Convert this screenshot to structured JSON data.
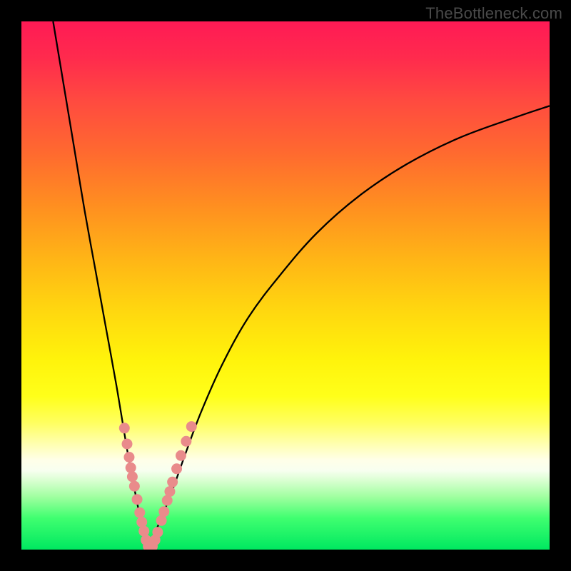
{
  "watermark": "TheBottleneck.com",
  "chart_data": {
    "type": "line",
    "title": "",
    "xlabel": "",
    "ylabel": "",
    "xlim": [
      0,
      100
    ],
    "ylim": [
      0,
      100
    ],
    "note": "Axes unlabeled; values estimated from pixels. Two curves form a V dipping near x≈24, y≈0.",
    "series": [
      {
        "name": "left-curve",
        "x": [
          6,
          8,
          10,
          12,
          14,
          16,
          18,
          20,
          21.5,
          22.5,
          23.5,
          24
        ],
        "y": [
          100,
          88,
          76,
          64,
          53,
          42,
          31,
          19,
          11,
          6,
          2,
          0
        ]
      },
      {
        "name": "right-curve",
        "x": [
          24,
          25,
          26.5,
          28.5,
          31,
          34,
          38,
          43,
          49,
          56,
          64,
          73,
          83,
          94,
          100
        ],
        "y": [
          0,
          2.5,
          6,
          11,
          18,
          26,
          35,
          44,
          52,
          60,
          67,
          73,
          78,
          82,
          84
        ]
      }
    ],
    "scatter_on_curves": {
      "name": "pink-dots",
      "color": "#e98b8b",
      "note": "Clustered along lower V; approximate positions",
      "points": [
        {
          "x": 19.5,
          "y": 23
        },
        {
          "x": 20.0,
          "y": 20
        },
        {
          "x": 20.4,
          "y": 17.5
        },
        {
          "x": 20.7,
          "y": 15.5
        },
        {
          "x": 21.0,
          "y": 13.8
        },
        {
          "x": 21.4,
          "y": 12
        },
        {
          "x": 21.9,
          "y": 9.5
        },
        {
          "x": 22.4,
          "y": 7
        },
        {
          "x": 22.8,
          "y": 5.2
        },
        {
          "x": 23.2,
          "y": 3.5
        },
        {
          "x": 23.6,
          "y": 1.8
        },
        {
          "x": 24.0,
          "y": 0.6
        },
        {
          "x": 24.4,
          "y": 0.6
        },
        {
          "x": 24.8,
          "y": 0.6
        },
        {
          "x": 25.3,
          "y": 1.8
        },
        {
          "x": 25.8,
          "y": 3.3
        },
        {
          "x": 26.5,
          "y": 5.5
        },
        {
          "x": 27.0,
          "y": 7.2
        },
        {
          "x": 27.6,
          "y": 9.3
        },
        {
          "x": 28.1,
          "y": 11
        },
        {
          "x": 28.6,
          "y": 12.8
        },
        {
          "x": 29.4,
          "y": 15.3
        },
        {
          "x": 30.2,
          "y": 17.8
        },
        {
          "x": 31.2,
          "y": 20.5
        },
        {
          "x": 32.2,
          "y": 23.3
        }
      ]
    },
    "background_gradient": {
      "direction": "top-to-bottom",
      "stops": [
        {
          "pos": 0.0,
          "color": "#ff1a55"
        },
        {
          "pos": 0.35,
          "color": "#ff8f20"
        },
        {
          "pos": 0.64,
          "color": "#fff30b"
        },
        {
          "pos": 0.85,
          "color": "#f8fff0"
        },
        {
          "pos": 1.0,
          "color": "#00e860"
        }
      ]
    }
  }
}
